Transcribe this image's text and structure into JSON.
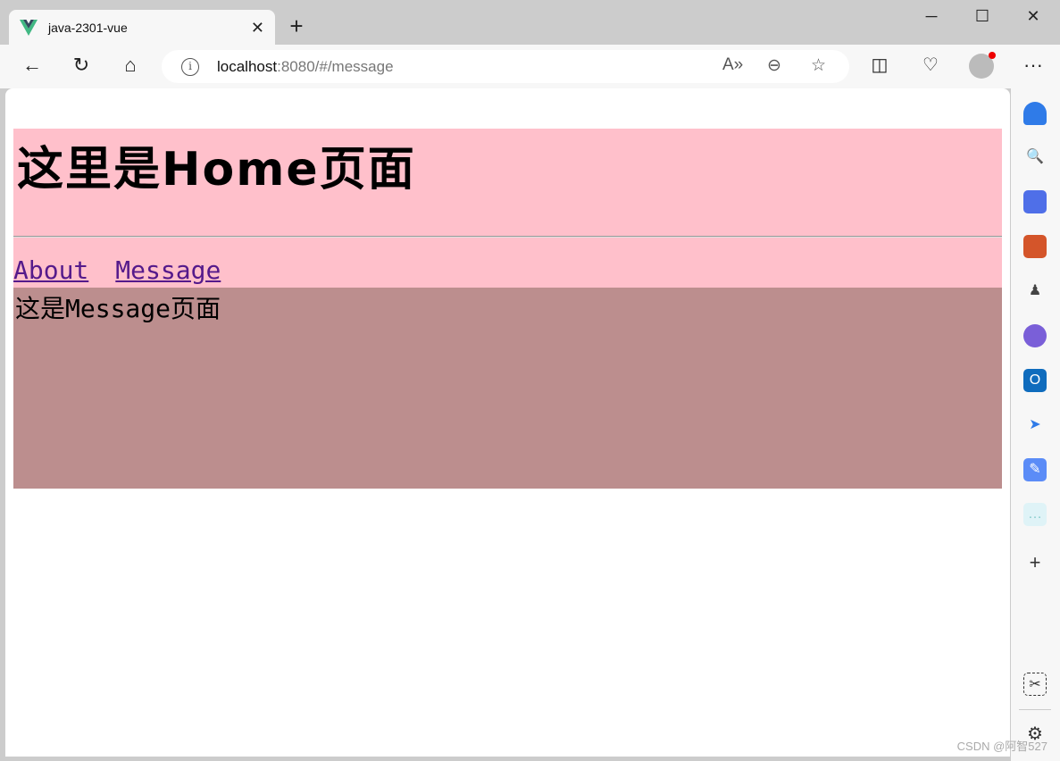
{
  "browser": {
    "tab_title": "java-2301-vue",
    "url_host": "localhost",
    "url_rest": ":8080/#/message",
    "icons": [
      "vue-logo-icon",
      "close-icon",
      "plus-icon",
      "back-icon",
      "refresh-icon",
      "home-icon",
      "info-icon",
      "read-aloud-icon",
      "zoom-out-icon",
      "favorite-star-icon",
      "split-screen-icon",
      "browser-essentials-icon",
      "profile-avatar-icon",
      "more-icon"
    ],
    "sidebar_icons": [
      "notifications-icon",
      "search-icon",
      "shopping-tag-icon",
      "tools-icon",
      "games-icon",
      "copilot-icon",
      "outlook-icon",
      "send-icon",
      "drop-icon",
      "chat-icon",
      "add-icon",
      "screenshot-icon",
      "settings-icon"
    ]
  },
  "page": {
    "heading": "这里是Home页面",
    "links": [
      {
        "label": "About"
      },
      {
        "label": "Message"
      }
    ],
    "message_text": "这是Message页面"
  },
  "colors": {
    "header_bg": "#ffc0cb",
    "message_bg": "#bc8e8e",
    "link": "#551a8b"
  },
  "watermark": "CSDN @阿智527"
}
